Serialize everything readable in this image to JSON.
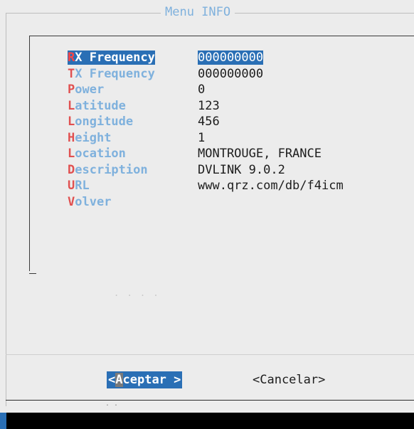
{
  "dialog": {
    "title": "Menu INFO"
  },
  "menu": {
    "items": [
      {
        "hotkey": "R",
        "rest": "X Frequency",
        "value": "000000000",
        "selected": true
      },
      {
        "hotkey": "T",
        "rest": "X Frequency",
        "value": "000000000",
        "selected": false
      },
      {
        "hotkey": "P",
        "rest": "ower",
        "value": "0",
        "selected": false
      },
      {
        "hotkey": "L",
        "rest": "atitude",
        "value": "123",
        "selected": false
      },
      {
        "hotkey": "L",
        "rest": "ongitude",
        "value": "456",
        "selected": false
      },
      {
        "hotkey": "H",
        "rest": "eight",
        "value": "1",
        "selected": false
      },
      {
        "hotkey": "L",
        "rest": "ocation",
        "value": "MONTROUGE, FRANCE",
        "selected": false
      },
      {
        "hotkey": "D",
        "rest": "escription",
        "value": "DVLINK 9.0.2",
        "selected": false
      },
      {
        "hotkey": "U",
        "rest": "RL",
        "value": "www.qrz.com/db/f4icm",
        "selected": false
      },
      {
        "hotkey": "V",
        "rest": "olver",
        "value": "",
        "selected": false
      }
    ]
  },
  "buttons": {
    "ok": {
      "open": "<",
      "hotkey": "A",
      "rest": "ceptar",
      "close": " >"
    },
    "cancel": {
      "label": "<Cancelar>"
    }
  },
  "colors": {
    "label": "#7fb1dd",
    "hotkey": "#e05050",
    "selection": "#2a6fb5",
    "background": "#ececec"
  }
}
